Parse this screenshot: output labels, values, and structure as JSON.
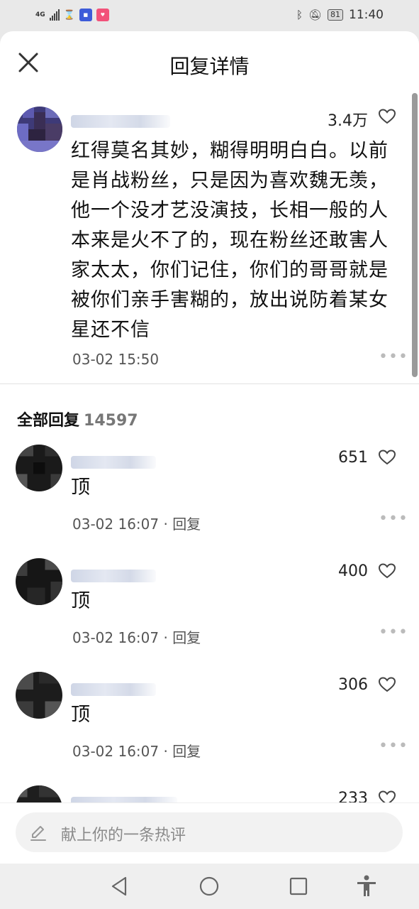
{
  "status_bar": {
    "network": "4G",
    "time": "11:40",
    "battery": "81"
  },
  "header": {
    "title": "回复详情"
  },
  "main_comment": {
    "likes": "3.4万",
    "text": "红得莫名其妙，糊得明明白白。以前是肖战粉丝，只是因为喜欢魏无羡，他一个没才艺没演技，长相一般的人本来是火不了的，现在粉丝还敢害人家太太，你们记住，你们的哥哥就是被你们亲手害糊的，放出说防着某女星还不信",
    "time": "03-02 15:50",
    "more": "•••"
  },
  "replies_section": {
    "label": "全部回复",
    "count": "14597"
  },
  "replies": [
    {
      "likes": "651",
      "text": "顶",
      "time": "03-02 16:07",
      "reply_label": "回复",
      "more": "•••"
    },
    {
      "likes": "400",
      "text": "顶",
      "time": "03-02 16:07",
      "reply_label": "回复",
      "more": "•••"
    },
    {
      "likes": "306",
      "text": "顶",
      "time": "03-02 16:07",
      "reply_label": "回复",
      "more": "•••"
    },
    {
      "likes": "233"
    }
  ],
  "input": {
    "placeholder": "献上你的一条热评"
  },
  "icons": {
    "close": "close-icon",
    "heart": "heart-outline-icon",
    "pen": "pen-icon",
    "back": "back-triangle-icon",
    "home": "home-circle-icon",
    "recents": "recents-square-icon",
    "accessibility": "accessibility-icon"
  },
  "colors": {
    "sheet_background": "#ffffff",
    "page_background": "#e9e9e9",
    "muted_text": "#777777",
    "input_background": "#f2f2f2"
  }
}
